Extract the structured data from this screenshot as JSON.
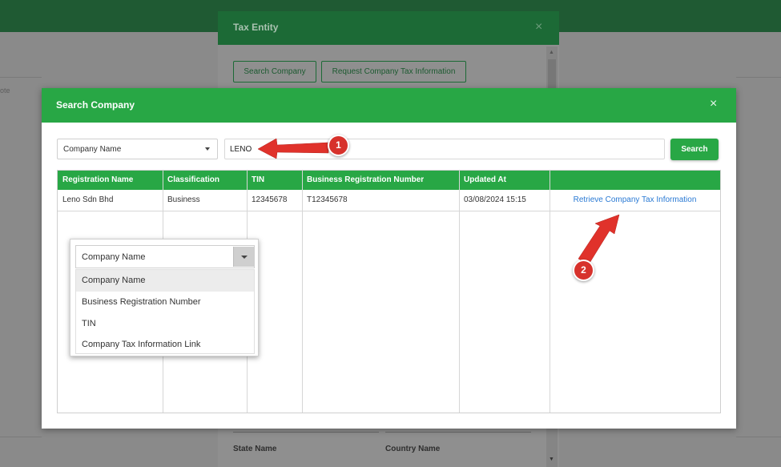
{
  "background": {
    "note_text": "ote",
    "tax_entity_dialog": {
      "title": "Tax Entity",
      "close_glyph": "×",
      "buttons": [
        "Search Company",
        "Request Company Tax Information"
      ],
      "labels": [
        "State Name",
        "Country Name"
      ]
    }
  },
  "modal": {
    "title": "Search Company",
    "close_glyph": "×",
    "search_by": {
      "selected": "Company Name"
    },
    "search_input": {
      "value": "LENO"
    },
    "search_button": "Search",
    "table": {
      "columns": [
        "Registration Name",
        "Classification",
        "TIN",
        "Business Registration Number",
        "Updated At",
        ""
      ],
      "rows": [
        {
          "registration_name": "Leno Sdn Bhd",
          "classification": "Business",
          "tin": "12345678",
          "business_registration_number": "T12345678",
          "updated_at": "03/08/2024 15:15",
          "action": "Retrieve Company Tax Information"
        }
      ]
    }
  },
  "dropdown_popup": {
    "selected": "Company Name",
    "options": [
      "Company Name",
      "Business Registration Number",
      "TIN",
      "Company Tax Information Link"
    ]
  },
  "markers": [
    "1",
    "2"
  ],
  "colors": {
    "primary_green": "#28a745",
    "marker_red": "#d7322c",
    "link_blue": "#2a7ad4"
  }
}
